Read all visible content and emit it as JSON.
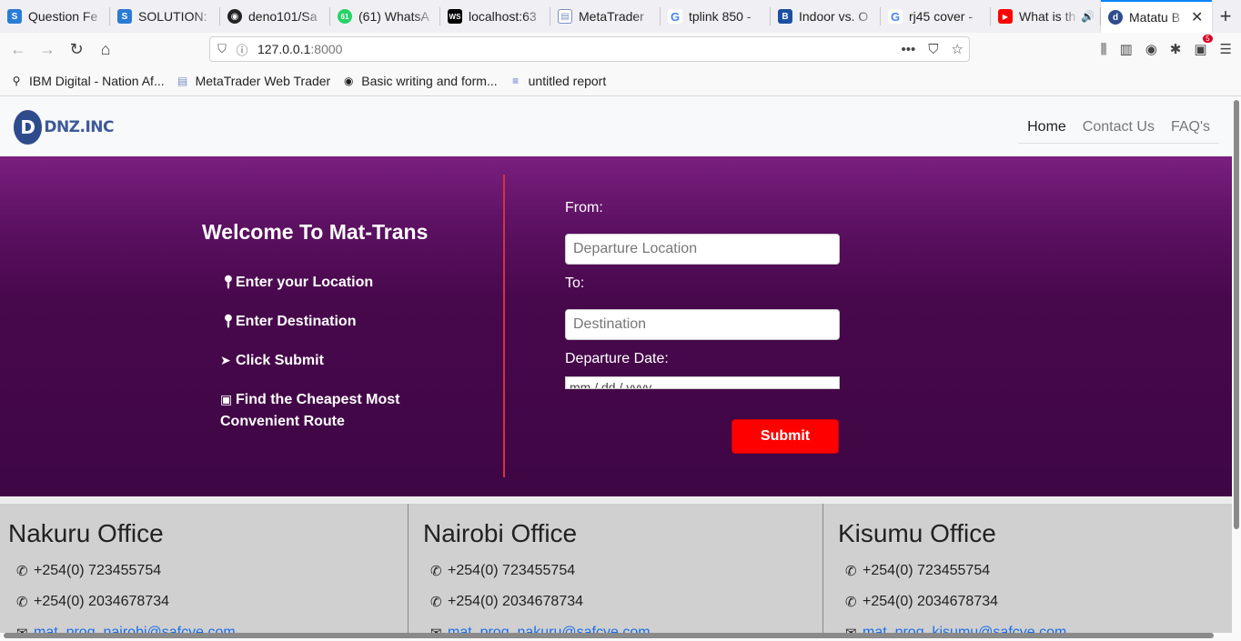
{
  "browser": {
    "tabs": [
      {
        "label": "Question Fe",
        "favicon": "S",
        "color": "#2a7bd5"
      },
      {
        "label": "SOLUTION:",
        "favicon": "S",
        "color": "#2a7bd5"
      },
      {
        "label": "deno101/Sa",
        "favicon": "github-icon",
        "color": "#222222"
      },
      {
        "label": "(61) WhatsA",
        "favicon": "61",
        "color": "#25d366"
      },
      {
        "label": "localhost:63",
        "favicon": "WS",
        "color": "#000000"
      },
      {
        "label": "MetaTrader",
        "favicon": "doc",
        "color": "#7b8fc4"
      },
      {
        "label": "tplink 850 -",
        "favicon": "G",
        "color": "#4285f4"
      },
      {
        "label": "Indoor vs. O",
        "favicon": "B",
        "color": "#1c4fa0"
      },
      {
        "label": "rj45 cover -",
        "favicon": "G",
        "color": "#4285f4"
      },
      {
        "label": "What is th",
        "favicon": "yt",
        "color": "#ff0000"
      },
      {
        "label": "Matatu B",
        "favicon": "d",
        "color": "#2e4c8c"
      }
    ],
    "url_host": "127.0.0.1",
    "url_port": ":8000",
    "extension_badge": "5",
    "bookmarks": [
      {
        "label": "IBM Digital - Nation Af...",
        "icon": "bike-icon"
      },
      {
        "label": "MetaTrader Web Trader",
        "icon": "doc-icon"
      },
      {
        "label": "Basic writing and form...",
        "icon": "github-icon"
      },
      {
        "label": "untitled report",
        "icon": "report-icon"
      }
    ]
  },
  "site": {
    "logo_mark": "D",
    "logo_text": "DNZ.INC",
    "nav": [
      {
        "label": "Home",
        "active": true
      },
      {
        "label": "Contact Us",
        "active": false
      },
      {
        "label": "FAQ's",
        "active": false
      }
    ]
  },
  "hero": {
    "welcome": "Welcome To Mat-Trans",
    "steps": [
      {
        "label": "Enter your Location",
        "icon": "map-marker-icon"
      },
      {
        "label": "Enter Destination",
        "icon": "map-marker-icon"
      },
      {
        "label": "Click Submit",
        "icon": "mouse-pointer-icon"
      },
      {
        "label": "Find the Cheapest Most Convenient Route",
        "icon": "bus-icon"
      }
    ],
    "colors": {
      "accent": "#ff0000",
      "divider": "#d33340",
      "bg_top": "#7a1f7e",
      "bg_bottom": "#3e0644"
    }
  },
  "form": {
    "from_label": "From:",
    "from_placeholder": "Departure Location",
    "to_label": "To:",
    "to_placeholder": "Destination",
    "date_label": "Departure Date:",
    "date_placeholder": "mm / dd / yyyy",
    "submit_label": "Submit"
  },
  "offices": [
    {
      "name": "Nakuru Office",
      "phone1": "+254(0) 723455754",
      "phone2": "+254(0) 2034678734",
      "email": "mat_prog_nairobi@safcye.com"
    },
    {
      "name": "Nairobi Office",
      "phone1": "+254(0) 723455754",
      "phone2": "+254(0) 2034678734",
      "email": "mat_prog_nakuru@safcye.com"
    },
    {
      "name": "Kisumu Office",
      "phone1": "+254(0) 723455754",
      "phone2": "+254(0) 2034678734",
      "email": "mat_prog_kisumu@safcye.com"
    }
  ]
}
